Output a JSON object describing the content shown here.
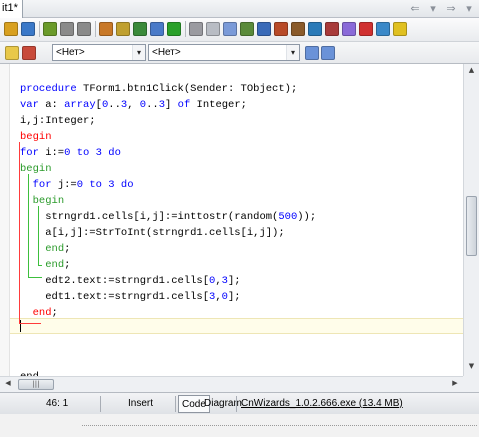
{
  "tab": {
    "title": "it1*"
  },
  "nav": {
    "back": "⇐",
    "back_drop": "▾",
    "forward": "⇒",
    "forward_drop": "▾"
  },
  "toolbar": {
    "combo_left": {
      "value": "<Нет>",
      "drop": "▾"
    },
    "combo_right": {
      "value": "<Нет>",
      "drop": "▾"
    },
    "icon_colors": [
      "#d8a020",
      "#3a78c8",
      "#6a9a2a",
      "#8a8a8a",
      "#8a8a8a",
      "#c87828",
      "#c0a030",
      "#3a8a3a",
      "#4a7ac8",
      "#2aa02a",
      "#9a9aa0",
      "#b8bcc4",
      "#7a9ad8",
      "#5a8a3a",
      "#3a6ab8",
      "#b84a28",
      "#8a5a2a",
      "#2a7ab8",
      "#a83a3a",
      "#8a6ad8",
      "#d03030",
      "#3a88c8",
      "#e0c020"
    ]
  },
  "editor": {
    "lines": [
      {
        "parts": [
          {
            "t": "procedure",
            "c": "kw"
          },
          {
            "t": " TForm1.btn1Click(Sender: TObject);",
            "c": ""
          }
        ]
      },
      {
        "parts": [
          {
            "t": "var",
            "c": "kw"
          },
          {
            "t": " a: ",
            "c": ""
          },
          {
            "t": "array",
            "c": "kw"
          },
          {
            "t": "[",
            "c": ""
          },
          {
            "t": "0",
            "c": "num"
          },
          {
            "t": "..",
            "c": ""
          },
          {
            "t": "3",
            "c": "num"
          },
          {
            "t": ", ",
            "c": ""
          },
          {
            "t": "0",
            "c": "num"
          },
          {
            "t": "..",
            "c": ""
          },
          {
            "t": "3",
            "c": "num"
          },
          {
            "t": "] ",
            "c": ""
          },
          {
            "t": "of",
            "c": "kw"
          },
          {
            "t": " Integer;",
            "c": ""
          }
        ]
      },
      {
        "parts": [
          {
            "t": "i,j:Integer;",
            "c": ""
          }
        ]
      },
      {
        "parts": [
          {
            "t": "begin",
            "c": "bg"
          }
        ]
      },
      {
        "parts": [
          {
            "t": "for",
            "c": "kw"
          },
          {
            "t": " i:=",
            "c": ""
          },
          {
            "t": "0",
            "c": "num"
          },
          {
            "t": " ",
            "c": ""
          },
          {
            "t": "to",
            "c": "kw"
          },
          {
            "t": " ",
            "c": ""
          },
          {
            "t": "3",
            "c": "num"
          },
          {
            "t": " ",
            "c": ""
          },
          {
            "t": "do",
            "c": "kw"
          }
        ]
      },
      {
        "parts": [
          {
            "t": "begin",
            "c": "hl"
          }
        ]
      },
      {
        "parts": [
          {
            "t": "  ",
            "c": ""
          },
          {
            "t": "for",
            "c": "kw"
          },
          {
            "t": " j:=",
            "c": ""
          },
          {
            "t": "0",
            "c": "num"
          },
          {
            "t": " ",
            "c": ""
          },
          {
            "t": "to",
            "c": "kw"
          },
          {
            "t": " ",
            "c": ""
          },
          {
            "t": "3",
            "c": "num"
          },
          {
            "t": " ",
            "c": ""
          },
          {
            "t": "do",
            "c": "kw"
          }
        ]
      },
      {
        "parts": [
          {
            "t": "  ",
            "c": ""
          },
          {
            "t": "begin",
            "c": "hl"
          }
        ]
      },
      {
        "parts": [
          {
            "t": "    strngrd1.cells[i,j]:=inttostr(random(",
            "c": ""
          },
          {
            "t": "500",
            "c": "num"
          },
          {
            "t": "));",
            "c": ""
          }
        ]
      },
      {
        "parts": [
          {
            "t": "    a[i,j]:=StrToInt(strngrd1.cells[i,j]);",
            "c": ""
          }
        ]
      },
      {
        "parts": [
          {
            "t": "    ",
            "c": ""
          },
          {
            "t": "end",
            "c": "hl"
          },
          {
            "t": ";",
            "c": ""
          }
        ]
      },
      {
        "parts": [
          {
            "t": "    ",
            "c": ""
          },
          {
            "t": "end",
            "c": "hl"
          },
          {
            "t": ";",
            "c": ""
          }
        ]
      },
      {
        "parts": [
          {
            "t": "    edt2.text:=strngrd1.cells[",
            "c": ""
          },
          {
            "t": "0",
            "c": "num"
          },
          {
            "t": ",",
            "c": ""
          },
          {
            "t": "3",
            "c": "num"
          },
          {
            "t": "];",
            "c": ""
          }
        ]
      },
      {
        "parts": [
          {
            "t": "    edt1.text:=strngrd1.cells[",
            "c": ""
          },
          {
            "t": "3",
            "c": "num"
          },
          {
            "t": ",",
            "c": ""
          },
          {
            "t": "0",
            "c": "num"
          },
          {
            "t": "];",
            "c": ""
          }
        ]
      },
      {
        "parts": [
          {
            "t": "  ",
            "c": ""
          },
          {
            "t": "end",
            "c": "bg"
          },
          {
            "t": ";",
            "c": ""
          }
        ]
      },
      {
        "parts": []
      },
      {
        "parts": []
      },
      {
        "parts": []
      },
      {
        "parts": [
          {
            "t": "end.",
            "c": ""
          }
        ]
      }
    ]
  },
  "status": {
    "position": "46:  1",
    "mode": "Insert",
    "tab_code": "Code",
    "tab_diagram": "Diagram",
    "cnwizards": "CnWizards_1.0.2.666.exe (13.4 MB)"
  }
}
